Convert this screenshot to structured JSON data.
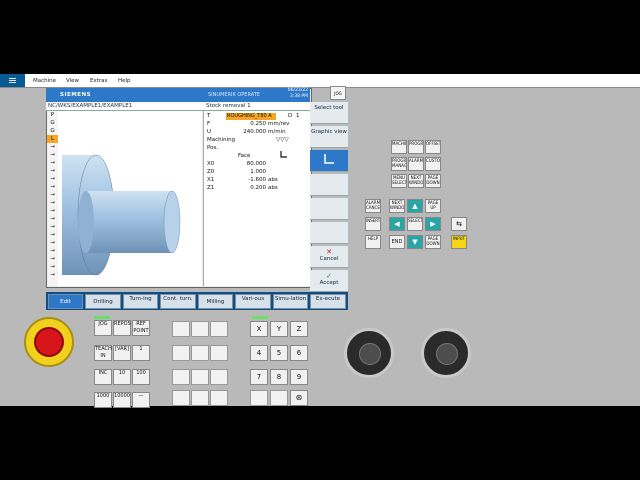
{
  "menu": {
    "items": [
      "Machine",
      "View",
      "Extras",
      "Help"
    ]
  },
  "screen": {
    "brand": "SIEMENS",
    "product": "SINUMERIK OPERATE",
    "date": "06/23/22",
    "time": "3:38 PM",
    "path": "NC/WKS/EXAMPLE1/EXAMPLE1",
    "dialog_title": "Stock removal 1",
    "gcode_labels": [
      "P",
      "G",
      "G",
      "L",
      "",
      "",
      "",
      "",
      "",
      "",
      "",
      "",
      "",
      "",
      "",
      "",
      "",
      "",
      "",
      "",
      ""
    ],
    "params": {
      "tool_label": "T",
      "tool_value": "ROUGHING_T80 A",
      "d_label": "D",
      "d_value": "1",
      "f_label": "F",
      "f_value": "0.250",
      "f_unit": "mm/rev",
      "s_label": "U",
      "s_value": "240.000",
      "s_unit": "m/min",
      "machining_label": "Machining",
      "machining_value": "▽▽▽",
      "pos_label": "Pos.",
      "face_label": "Face",
      "x0_label": "X0",
      "x0_value": "80.000",
      "z0_label": "Z0",
      "z0_value": "1.000",
      "x1_label": "X1",
      "x1_value": "-1.600",
      "x1_unit": "abs",
      "z1_label": "Z1",
      "z1_value": "0.200",
      "z1_unit": "abs"
    },
    "vsoft": {
      "jog": "JOG",
      "select_tool": "Select tool",
      "graphic_view": "Graphic view",
      "cancel": "Cancel",
      "accept": "Accept"
    },
    "hsoft": {
      "edit": "Edit",
      "drilling": "Drilling",
      "turning": "Turn-ing",
      "cont_turn": "Cont. turn.",
      "milling": "Milling",
      "various": "Vari-ous",
      "simulation": "Simu-lation",
      "execute": "Ex-ecute"
    }
  },
  "keypad_top": {
    "r1": [
      "MACHINE",
      "PROGRAM",
      "OFFSET"
    ],
    "r2": [
      "PROGRAM MANAGER",
      "ALARM",
      "CUSTOM"
    ],
    "r3": [
      "MENU SELECT",
      "NEXT WINDOW",
      "PAGE DOWN"
    ]
  },
  "keypad_nav": {
    "r1": [
      "ALARM CANCEL",
      "NEXT WINDOW",
      "PAGE UP"
    ],
    "r2": [
      "INSERT",
      "SELECT",
      "DEL"
    ],
    "r3": [
      "HELP",
      "END",
      "PAGE DOWN",
      "INPUT"
    ]
  },
  "mcp": {
    "left": [
      "JOG",
      "REPOS",
      "REF POINT",
      "TEACH IN",
      "[VAR]",
      "1",
      "INC",
      "10",
      "100",
      "1000",
      "10000",
      "—"
    ],
    "xyz": [
      "X",
      "Y",
      "Z"
    ],
    "nums": [
      "4",
      "5",
      "6",
      "7",
      "8",
      "9"
    ]
  },
  "colors": {
    "screen_header": "#2d78c8",
    "softkey_bar": "#0e4f86",
    "selected": "#f5a623",
    "emergency": "#d8151b"
  }
}
